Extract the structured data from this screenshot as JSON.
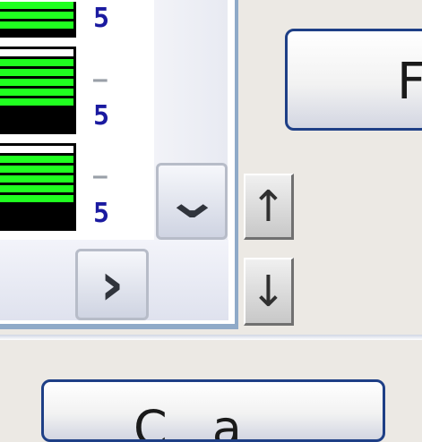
{
  "list": {
    "rows": [
      {
        "level_label": "5",
        "bars_filled": 3,
        "bars_total": 3
      },
      {
        "level_label": "5",
        "dash": "–",
        "bars_filled": 5,
        "bars_total": 6
      },
      {
        "level_label": "5",
        "dash": "–",
        "bars_filled": 5,
        "bars_total": 6
      }
    ]
  },
  "scrollbar": {
    "down_icon": "chevron-down-icon",
    "right_icon": "chevron-right-icon",
    "down_glyph": "⌄",
    "right_glyph": "›"
  },
  "side_buttons": {
    "up_glyph": "↑",
    "down_glyph": "↓"
  },
  "buttons": {
    "top_label": "F",
    "bottom_label": "Ca"
  },
  "colors": {
    "meter_green": "#20ff20",
    "level_text": "#1a1aa0",
    "button_border": "#1e3f86",
    "frame_blue": "#8faac8"
  }
}
